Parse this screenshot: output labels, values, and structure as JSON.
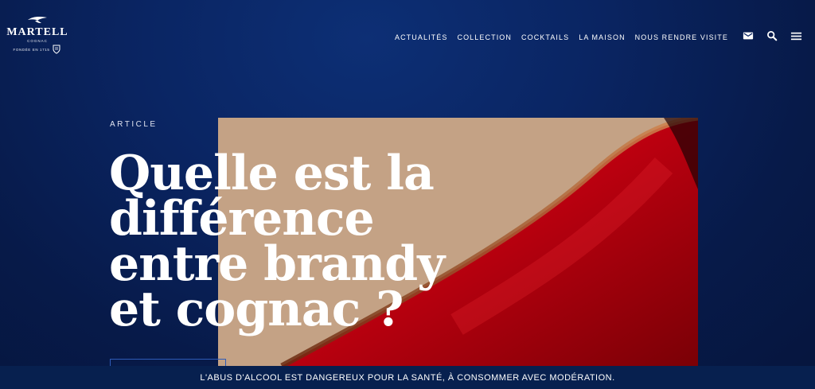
{
  "brand": {
    "name": "MARTELL",
    "subtitle": "COGNAC",
    "founded": "FONDÉE EN 1715"
  },
  "nav": {
    "items": [
      {
        "label": "ACTUALITÉS"
      },
      {
        "label": "COLLECTION"
      },
      {
        "label": "COCKTAILS"
      },
      {
        "label": "LA MAISON"
      },
      {
        "label": "NOUS RENDRE VISITE"
      }
    ]
  },
  "header_icons": [
    "mail-icon",
    "search-icon",
    "menu-icon"
  ],
  "hero": {
    "category": "ARTICLE",
    "title": "Quelle est la différence entre brandy et cognac ?"
  },
  "legal": {
    "warning": "L'ABUS D'ALCOOL EST DANGEREUX POUR LA SANTÉ, À CONSOMMER AVEC MODÉRATION."
  },
  "colors": {
    "background": "#0a2563",
    "warning_bar": "#07204f",
    "accent_red": "#c0000c",
    "cognac_tan": "#c4a285"
  }
}
